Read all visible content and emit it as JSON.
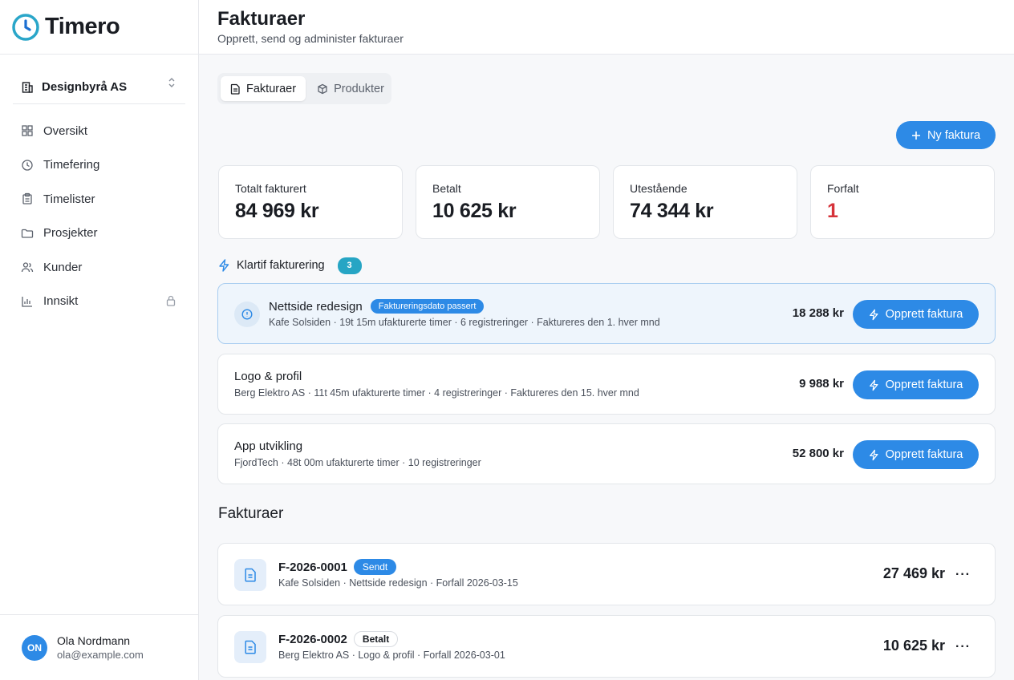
{
  "app": {
    "name": "Timero"
  },
  "sidebar": {
    "org": {
      "name": "Designbyrå AS"
    },
    "items": [
      {
        "label": "Oversikt",
        "icon": "grid-icon"
      },
      {
        "label": "Timefering",
        "icon": "clock-icon"
      },
      {
        "label": "Timelister",
        "icon": "clipboard-icon"
      },
      {
        "label": "Prosjekter",
        "icon": "folder-icon"
      },
      {
        "label": "Kunder",
        "icon": "users-icon"
      },
      {
        "label": "Innsikt",
        "icon": "bar-chart-icon",
        "locked": true
      }
    ],
    "user": {
      "initials": "ON",
      "name": "Ola Nordmann",
      "email": "ola@example.com"
    }
  },
  "header": {
    "title": "Fakturaer",
    "subtitle": "Opprett, send og administer fakturaer"
  },
  "tabs": [
    {
      "label": "Fakturaer",
      "active": true
    },
    {
      "label": "Produkter",
      "active": false
    }
  ],
  "actions": {
    "new_invoice": "Ny faktura"
  },
  "stats": [
    {
      "label": "Totalt fakturert",
      "value": "84 969 kr"
    },
    {
      "label": "Betalt",
      "value": "10 625 kr"
    },
    {
      "label": "Utestående",
      "value": "74 344 kr"
    },
    {
      "label": "Forfalt",
      "value": "1"
    }
  ],
  "quick_billing": {
    "title": "Klartif fakturering",
    "count": "3",
    "items": [
      {
        "title": "Nettside redesign",
        "badge": "Faktureringsdato passert",
        "subtitle": "Kafe Solsiden · 19t 15m ufakturerte timer · 6 registreringer · Faktureres den 1. hver mnd",
        "amount": "18 288 kr",
        "button": "Opprett faktura"
      },
      {
        "title": "Logo & profil",
        "subtitle": "Berg Elektro AS · 11t 45m ufakturerte timer · 4 registreringer · Faktureres den 15. hver mnd",
        "amount": "9 988 kr",
        "button": "Opprett faktura"
      },
      {
        "title": "App utvikling",
        "subtitle": "FjordTech · 48t 00m ufakturerte timer · 10 registreringer",
        "amount": "52 800 kr",
        "button": "Opprett faktura"
      }
    ]
  },
  "invoices": {
    "title": "Fakturaer",
    "items": [
      {
        "number": "F-2026-0001",
        "status": "Sendt",
        "subtitle": "Kafe Solsiden · Nettside redesign · Forfall 2026-03-15",
        "amount": "27 469 kr",
        "more": "···"
      },
      {
        "number": "F-2026-0002",
        "status": "Betalt",
        "subtitle": "Berg Elektro AS · Logo & profil · Forfall 2026-03-01",
        "amount": "10 625 kr",
        "more": "···"
      }
    ]
  },
  "colors": {
    "accent": "#2d8ae6",
    "teal": "#26a5c4",
    "danger": "#d6333a"
  }
}
